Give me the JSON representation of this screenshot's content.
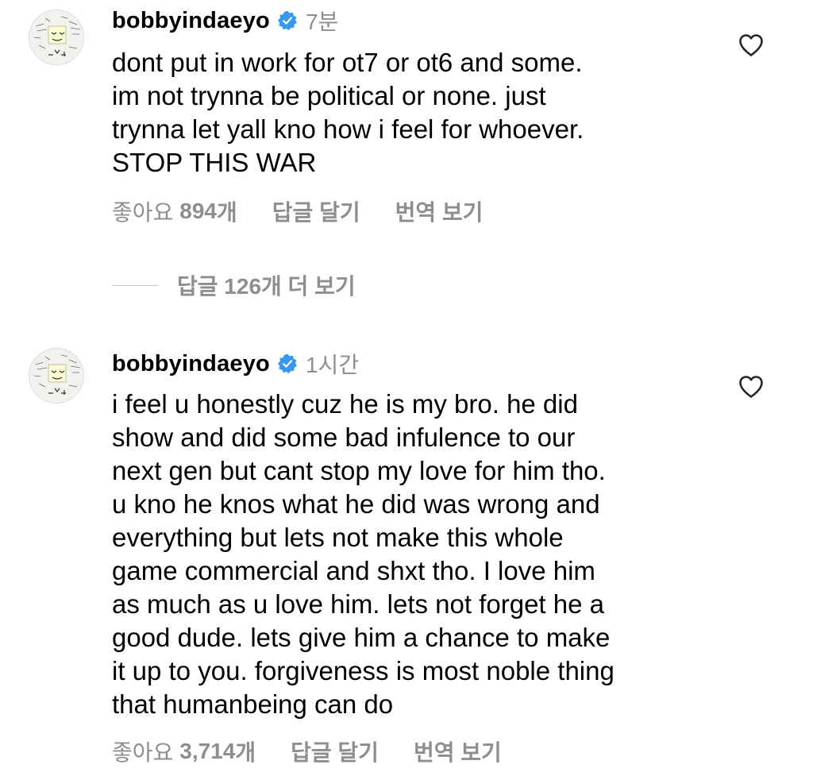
{
  "comments": [
    {
      "username": "bobbyindaeyo",
      "verified": true,
      "time": "7분",
      "text": "dont put in work for ot7 or ot6 and some.\nim not trynna be political or none. just\ntrynna let yall kno how i feel for whoever.\nSTOP THIS WAR",
      "likes_label": "좋아요",
      "likes_count": "894",
      "likes_suffix": "개",
      "reply_label": "답글 달기",
      "translate_label": "번역 보기",
      "view_replies": "답글 126개 더 보기"
    },
    {
      "username": "bobbyindaeyo",
      "verified": true,
      "time": "1시간",
      "text": "i feel u honestly cuz he is my bro. he did\nshow and did some bad infulence to our\nnext gen but cant stop my love for him tho.\nu kno he knos what he did was wrong and\neverything but lets not make this whole\ngame commercial and shxt tho. I love him\nas much as u love him. lets not forget he a\ngood dude. lets give him a chance to make\nit up to you. forgiveness is most noble thing\nthat humanbeing can do",
      "likes_label": "좋아요",
      "likes_count": "3,714",
      "likes_suffix": "개",
      "reply_label": "답글 달기",
      "translate_label": "번역 보기"
    }
  ],
  "colors": {
    "text": "#000000",
    "muted": "#8e8e8e",
    "verified": "#3897f0"
  },
  "icons": {
    "verified": "verified-badge-icon",
    "like": "heart-outline-icon",
    "avatar": "doodle-avatar"
  }
}
